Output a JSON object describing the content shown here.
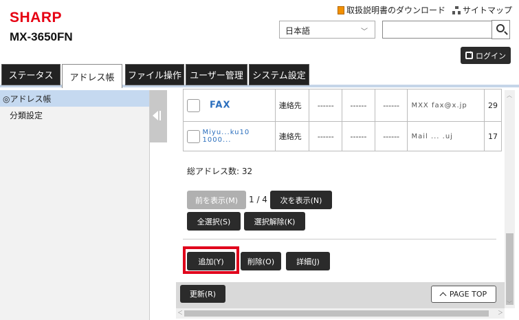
{
  "header": {
    "logo": "SHARP",
    "model": "MX-3650FN",
    "links": {
      "manual_download": "取扱説明書のダウンロード",
      "sitemap": "サイトマップ"
    },
    "language": {
      "selected": "日本語"
    },
    "search": {
      "value": ""
    },
    "login_label": "ログイン"
  },
  "tabs": [
    {
      "label": "ステータス"
    },
    {
      "label": "アドレス帳"
    },
    {
      "label": "ファイル操作"
    },
    {
      "label": "ユーザー管理"
    },
    {
      "label": "システム設定"
    }
  ],
  "sidebar": {
    "items": [
      {
        "label": "◎アドレス帳"
      },
      {
        "label": "分類設定"
      }
    ]
  },
  "table": {
    "rows": [
      {
        "name": "FAX",
        "type": "連絡先",
        "c1": "------",
        "c2": "------",
        "c3": "------",
        "address": "MXX fax@x.jp",
        "num": "29"
      },
      {
        "name": "Miyu...ku10 1000...",
        "type": "連絡先",
        "c1": "------",
        "c2": "------",
        "c3": "------",
        "address": "Mail ... .uj",
        "num": "17"
      }
    ]
  },
  "summary": {
    "total_label": "総アドレス数:",
    "total_value": "32"
  },
  "pagination": {
    "prev_label": "前を表示(M)",
    "page_info": "1 / 4",
    "next_label": "次を表示(N)"
  },
  "selection": {
    "select_all_label": "全選択(S)",
    "deselect_label": "選択解除(K)"
  },
  "actions": {
    "add_label": "追加(Y)",
    "delete_label": "削除(O)",
    "detail_label": "詳細(J)"
  },
  "footer": {
    "refresh_label": "更新(R)",
    "page_top_label": "PAGE TOP"
  }
}
